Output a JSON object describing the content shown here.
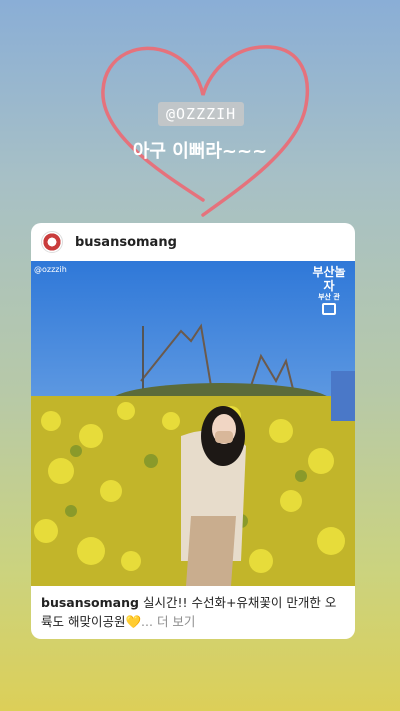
{
  "story": {
    "mention": "@OZZZIH",
    "text": "아구 이뻐라~~~",
    "heart_color": "#e5727c"
  },
  "post": {
    "username": "busansomang",
    "photo_credit": "@ozzzih",
    "photo_logo": "부산놀자",
    "photo_logo_sub": "부산 관",
    "caption_user": "busansomang",
    "caption_text": " 실시간!! 수선화+유채꽃이 만개한 오륙도 해맞이공원💛",
    "more_label": "... 더 보기"
  }
}
